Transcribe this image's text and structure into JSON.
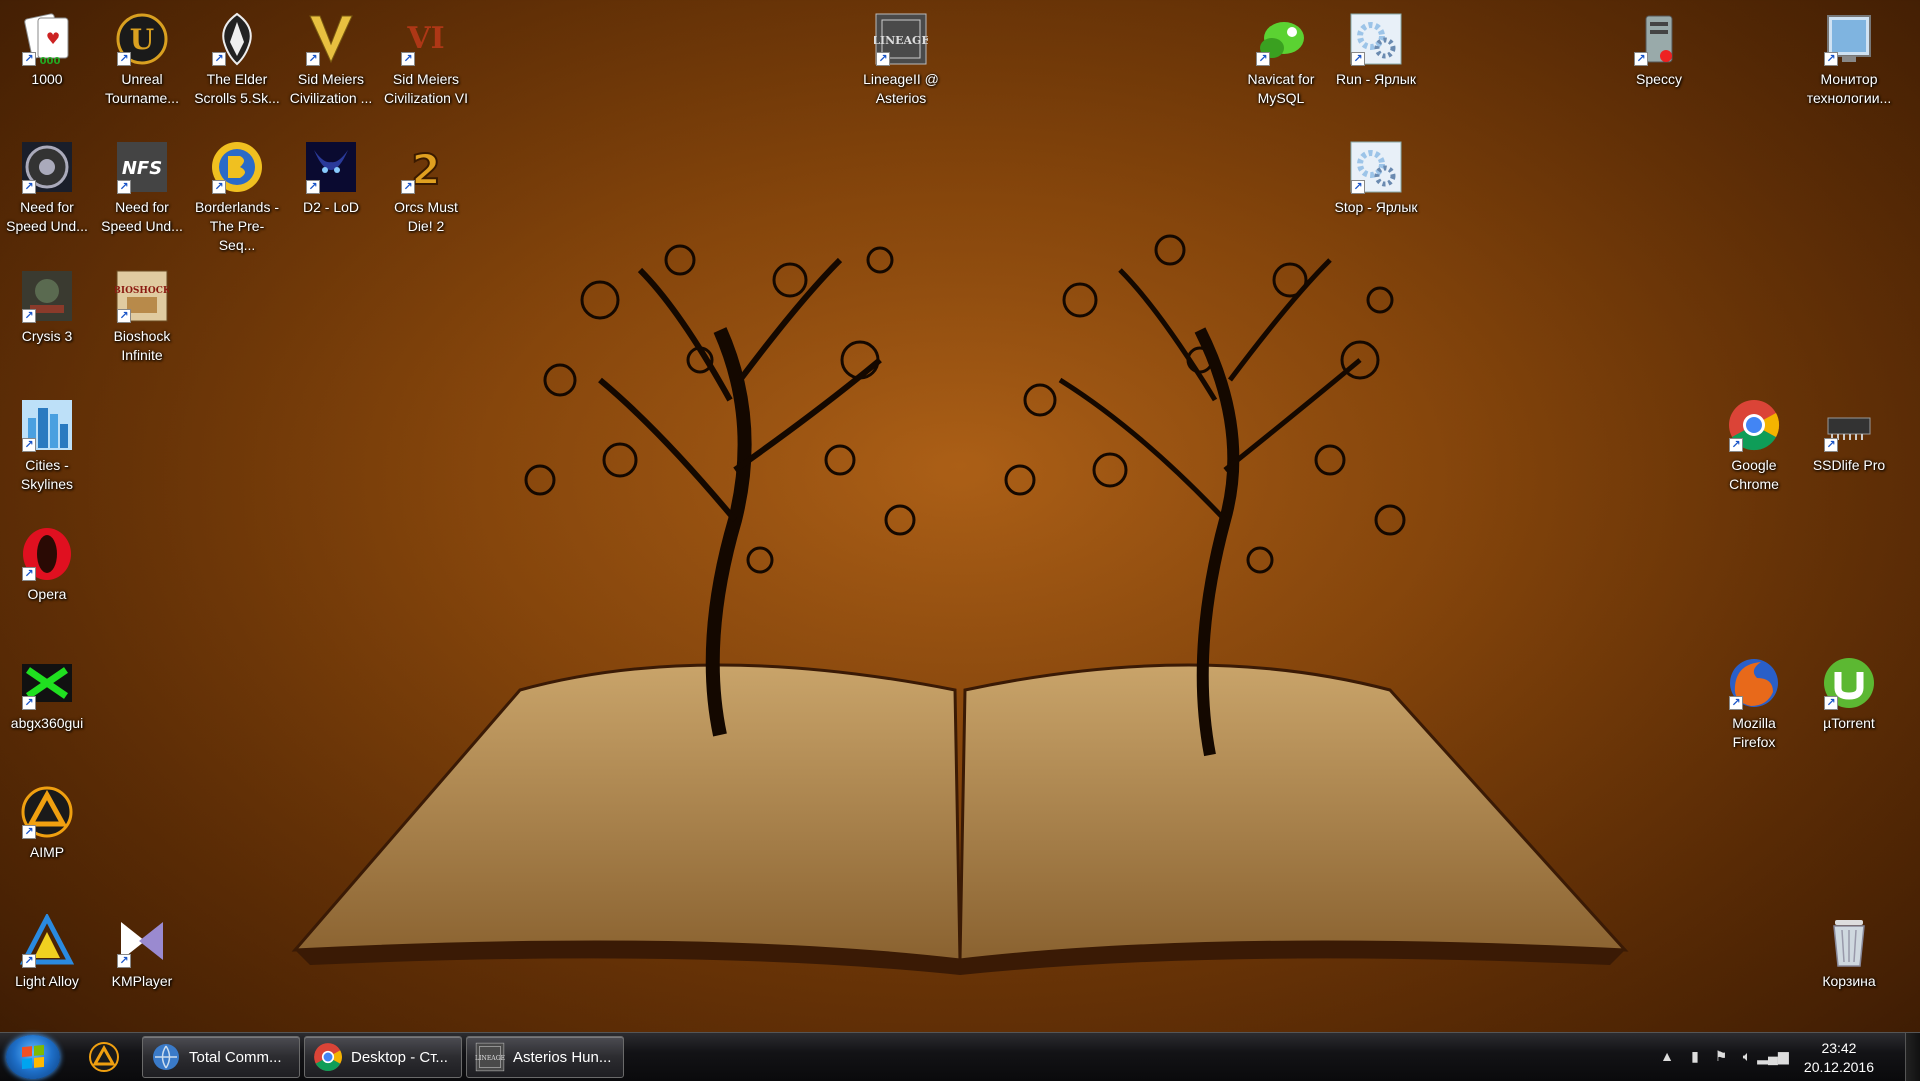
{
  "desktop": {
    "icons": [
      {
        "label": "1000",
        "icon": "cards-icon",
        "color": "#c22"
      },
      {
        "label": "Unreal Tourname...",
        "icon": "unreal-icon",
        "color": "#d9a020"
      },
      {
        "label": "The Elder Scrolls 5.Sk...",
        "icon": "skyrim-icon",
        "color": "#eee"
      },
      {
        "label": "Sid Meiers Civilization ...",
        "icon": "civ5-icon",
        "color": "#e8c040"
      },
      {
        "label": "Sid Meiers Civilization VI",
        "icon": "civ6-icon",
        "color": "#c23a1a"
      },
      {
        "label": "LineageII @ Asterios",
        "icon": "lineage-icon",
        "color": "#8a8a8a"
      },
      {
        "label": "Navicat for MySQL",
        "icon": "navicat-icon",
        "color": "#5bd232"
      },
      {
        "label": "Run - Ярлык",
        "icon": "gears-icon",
        "color": "#9cc4e8"
      },
      {
        "label": "Speccy",
        "icon": "speccy-icon",
        "color": "#bbb"
      },
      {
        "label": "Монитор технологии...",
        "icon": "monitor-icon",
        "color": "#7fb4e0"
      },
      {
        "label": "Need for Speed Und...",
        "icon": "nfs-wheel-icon",
        "color": "#556"
      },
      {
        "label": "Need for Speed Und...",
        "icon": "nfs-logo-icon",
        "color": "#888"
      },
      {
        "label": "Borderlands - The Pre-Seq...",
        "icon": "borderlands-icon",
        "color": "#f0c020"
      },
      {
        "label": "D2 - LoD",
        "icon": "diablo-icon",
        "color": "#2a3a9a"
      },
      {
        "label": "Orcs Must Die! 2",
        "icon": "orcs-icon",
        "color": "#e0a020"
      },
      {
        "label": "Stop - Ярлык",
        "icon": "gears-icon",
        "color": "#9cc4e8"
      },
      {
        "label": "Crysis 3",
        "icon": "crysis-icon",
        "color": "#8a3a2a"
      },
      {
        "label": "Bioshock Infinite",
        "icon": "bioshock-icon",
        "color": "#b88a4a"
      },
      {
        "label": "Cities - Skylines",
        "icon": "cities-icon",
        "color": "#4aa0e0"
      },
      {
        "label": "Google Chrome",
        "icon": "chrome-icon",
        "color": "#4285f4"
      },
      {
        "label": "SSDlife Pro",
        "icon": "ssd-icon",
        "color": "#666"
      },
      {
        "label": "Opera",
        "icon": "opera-icon",
        "color": "#e01020"
      },
      {
        "label": "abgx360gui",
        "icon": "abgx-icon",
        "color": "#20e020"
      },
      {
        "label": "Mozilla Firefox",
        "icon": "firefox-icon",
        "color": "#e8691a"
      },
      {
        "label": "µTorrent",
        "icon": "utorrent-icon",
        "color": "#5cb832"
      },
      {
        "label": "AIMP",
        "icon": "aimp-icon",
        "color": "#f0a010"
      },
      {
        "label": "Light Alloy",
        "icon": "lightalloy-icon",
        "color": "#2a8ae0"
      },
      {
        "label": "KMPlayer",
        "icon": "kmplayer-icon",
        "color": "#9a8ad0"
      },
      {
        "label": "Корзина",
        "icon": "recycle-bin-icon",
        "color": "#ccc"
      }
    ]
  },
  "taskbar": {
    "pinned": [
      {
        "icon": "aimp-icon",
        "color": "#f0a010"
      }
    ],
    "tasks": [
      {
        "label": "Total Comm...",
        "icon": "total-commander-icon",
        "color": "#3a7ac8"
      },
      {
        "label": "Desktop - Ст...",
        "icon": "chrome-icon",
        "color": "#4285f4"
      },
      {
        "label": "Asterios Hun...",
        "icon": "lineage-icon",
        "color": "#7a6a5a"
      }
    ],
    "clock": {
      "time": "23:42",
      "date": "20.12.2016"
    }
  }
}
